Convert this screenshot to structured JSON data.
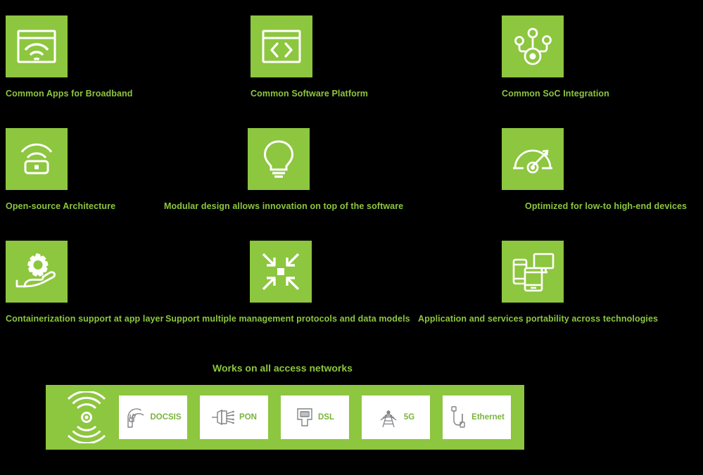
{
  "theme": {
    "accent_green": "#8dc63f",
    "card_label_green": "#7ab33d",
    "background": "#000000",
    "icon_stroke": "#ffffff",
    "card_icon_stroke": "#808285"
  },
  "features": {
    "rows": [
      {
        "cells": [
          {
            "icon": "browser-wifi-icon",
            "label": "Common Apps for Broadband"
          },
          {
            "icon": "code-window-icon",
            "label": "Common Software Platform"
          },
          {
            "icon": "soc-node-network-icon",
            "label": "Common SoC Integration"
          }
        ]
      },
      {
        "cells": [
          {
            "icon": "wireless-router-icon",
            "label": "Open-source Architecture"
          },
          {
            "icon": "lightbulb-icon",
            "label": "Modular design allows innovation on top of the software"
          },
          {
            "icon": "speedometer-icon",
            "label": "Optimized for low-to high-end devices"
          }
        ]
      },
      {
        "cells": [
          {
            "icon": "hand-holding-gear-icon",
            "label": "Containerization support at app layer"
          },
          {
            "icon": "converge-arrows-icon",
            "label": "Support multiple management protocols and data models"
          },
          {
            "icon": "multi-device-icon",
            "label": "Application and services portability across technologies"
          }
        ]
      }
    ]
  },
  "access_networks": {
    "heading": "Works on all access networks",
    "panel_icon": "radar-signal-icon",
    "cards": [
      {
        "icon": "coax-cable-icon",
        "label": "DOCSIS"
      },
      {
        "icon": "fiber-splitter-icon",
        "label": "PON"
      },
      {
        "icon": "rj45-jack-icon",
        "label": "DSL"
      },
      {
        "icon": "cell-tower-icon",
        "label": "5G"
      },
      {
        "icon": "ethernet-cable-icon",
        "label": "Ethernet"
      }
    ]
  }
}
